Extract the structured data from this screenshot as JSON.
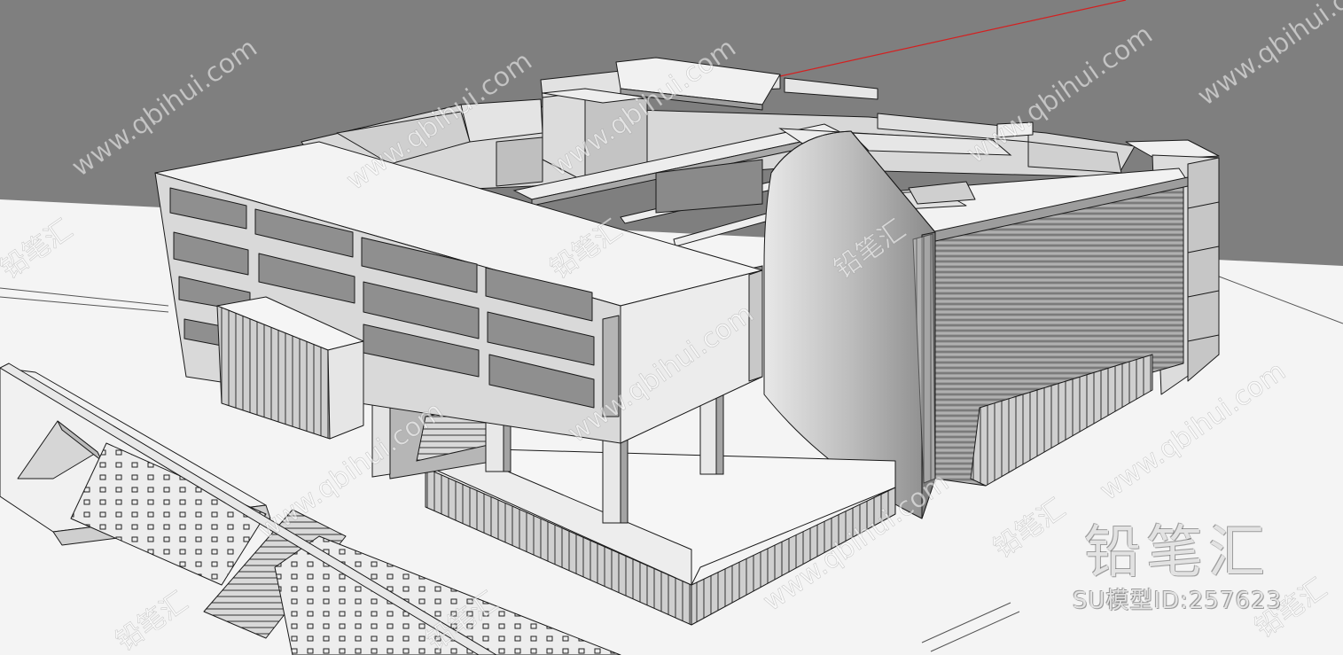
{
  "watermark": {
    "url_text": "www.qbihui.com",
    "cn_text": "铅笔汇"
  },
  "brand": {
    "name": "铅笔汇",
    "model_id": "SU模型ID:257623"
  },
  "colors": {
    "sky": "#7f7f7f",
    "ground": "#f4f4f4",
    "face_light": "#ececec",
    "face_mid": "#cfcfcf",
    "face_dark": "#9a9a9a",
    "glass": "#8e8e8e",
    "edge": "#1a1a1a",
    "axis_red": "#d42020"
  }
}
